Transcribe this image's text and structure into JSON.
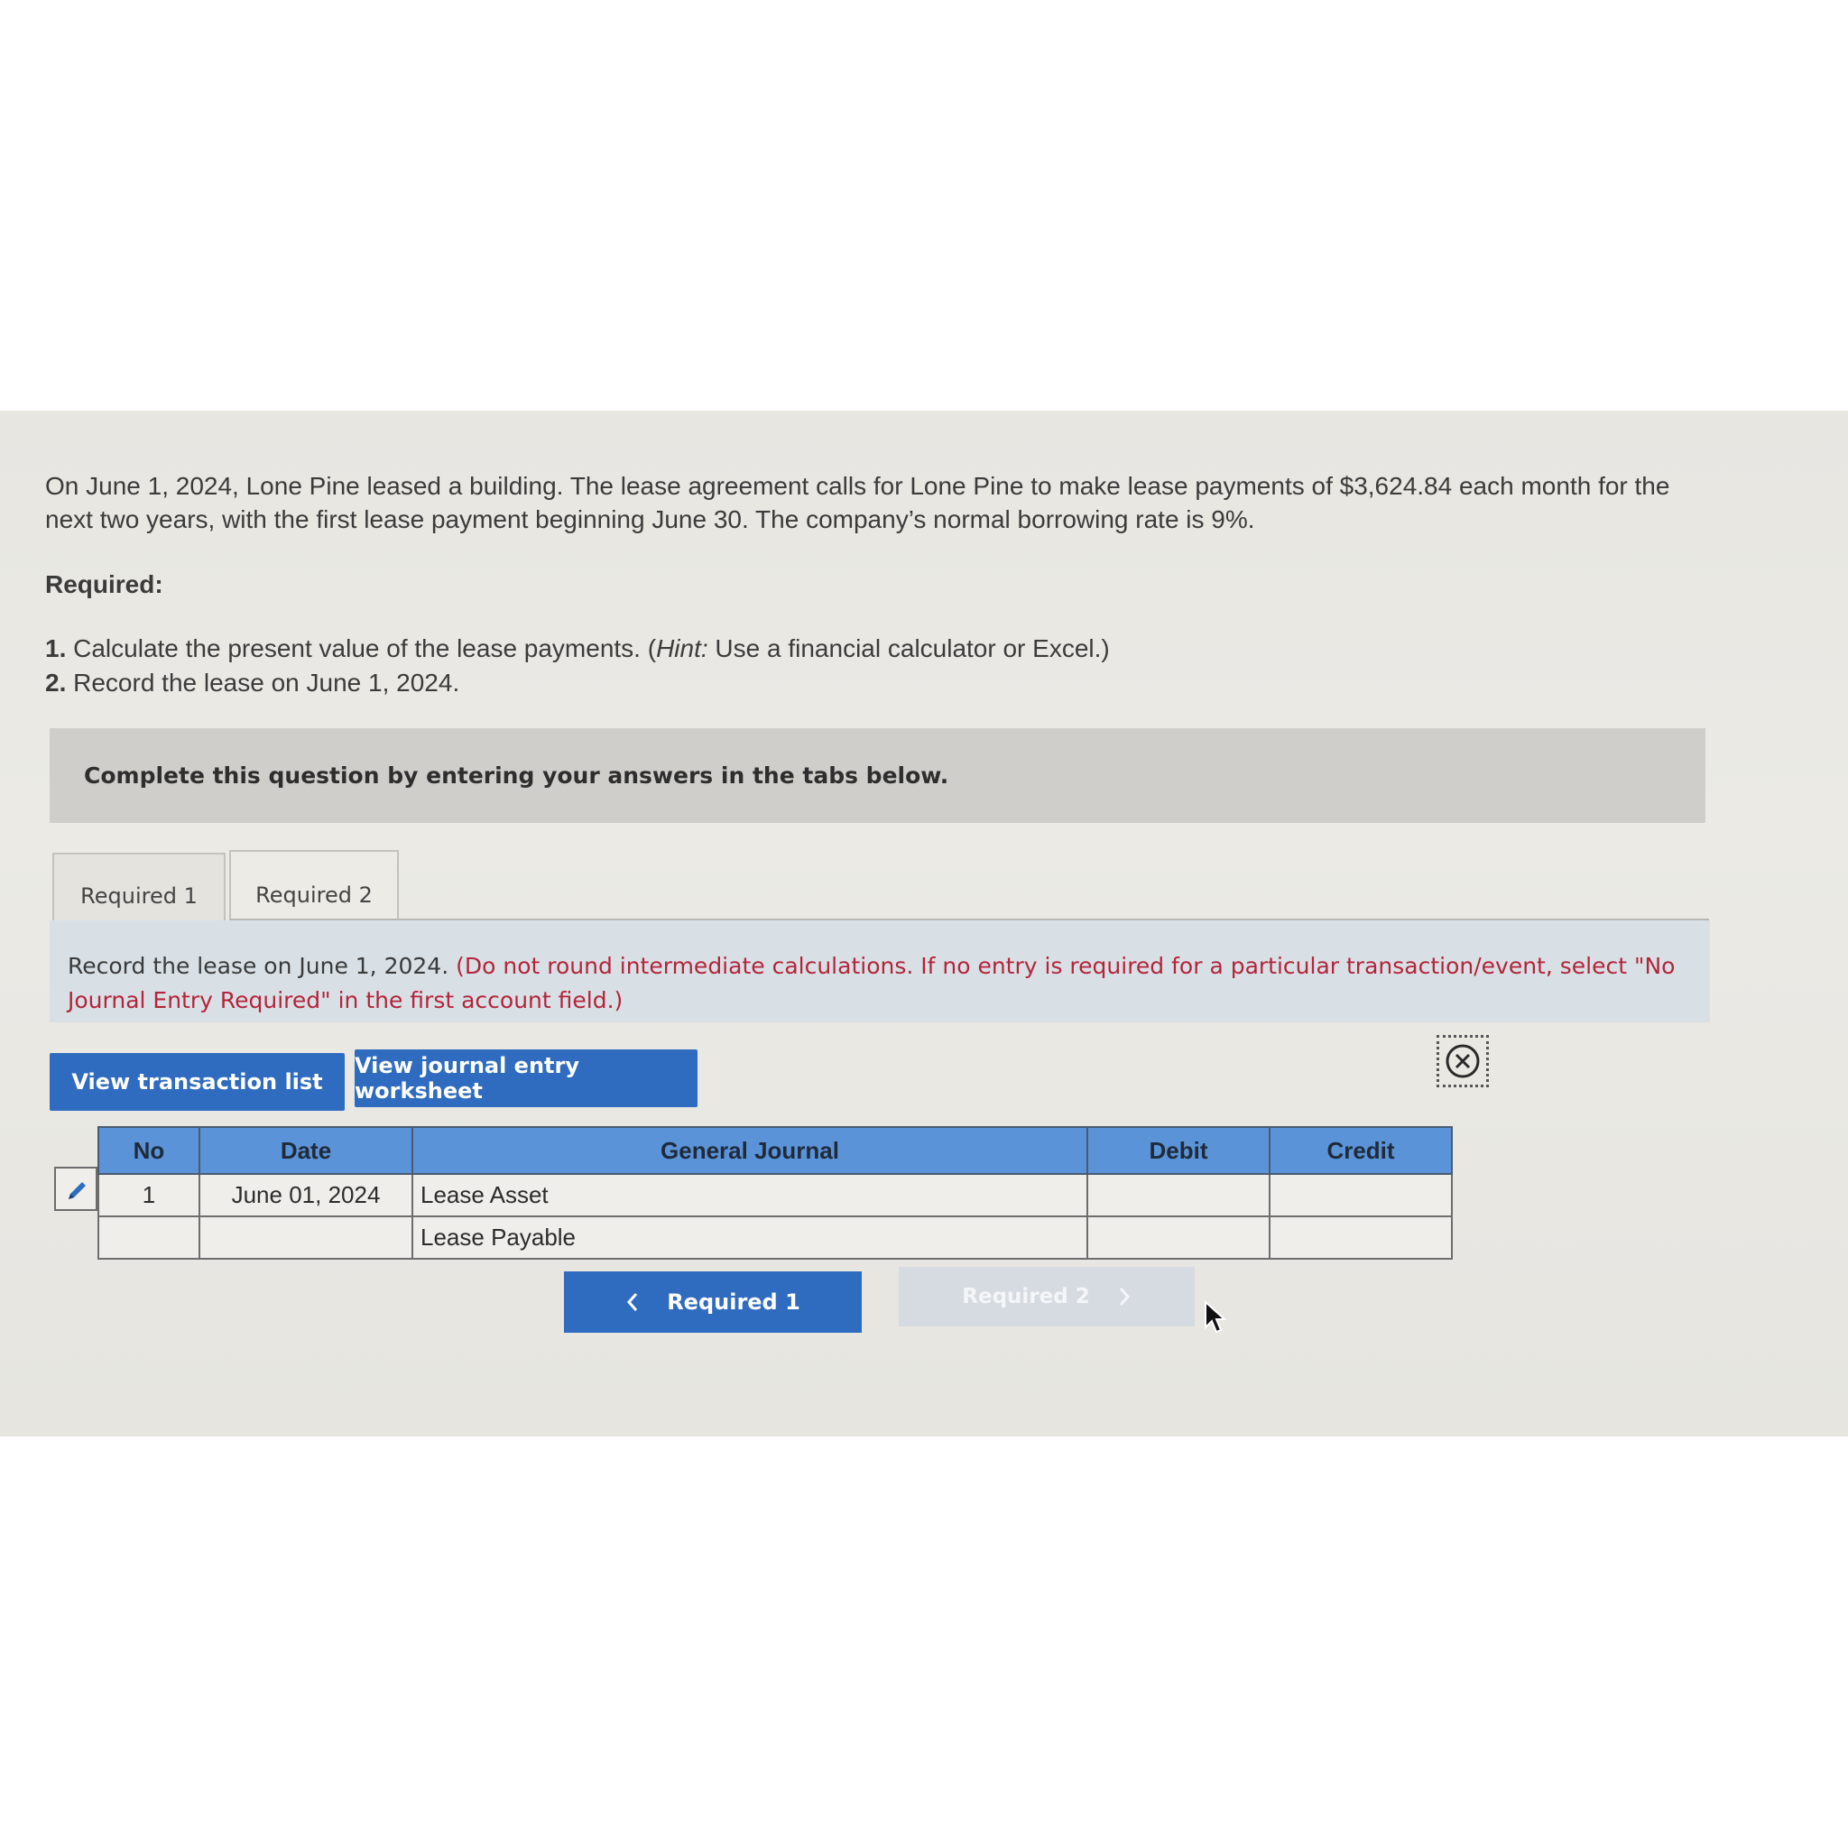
{
  "problem": {
    "text": "On June 1, 2024, Lone Pine leased a building. The lease agreement calls for Lone Pine to make lease payments of $3,624.84 each month for the next two years, with the first lease payment beginning June 30. The company’s normal borrowing rate is 9%."
  },
  "required": {
    "heading": "Required:",
    "items": [
      {
        "num": "1.",
        "text_before": " Calculate the present value of the lease payments. (",
        "hint": "Hint:",
        "text_after": " Use a financial calculator or Excel.)"
      },
      {
        "num": "2.",
        "text": " Record the lease on June 1, 2024."
      }
    ]
  },
  "banner": {
    "text": "Complete this question by entering your answers in the tabs below."
  },
  "tabs": [
    {
      "label": "Required 1",
      "active": false
    },
    {
      "label": "Required 2",
      "active": true
    }
  ],
  "instruction": {
    "lead": "Record the lease on June 1, 2024.",
    "note": " (Do not round intermediate calculations. If no entry is required for a particular transaction/event, select \"No Journal Entry Required\" in the first account field.)"
  },
  "buttons": {
    "view_transaction_list": "View transaction list",
    "view_journal_worksheet": "View journal entry worksheet"
  },
  "icons": {
    "close": "close-circle-icon",
    "edit": "pencil-icon",
    "cursor": "mouse-pointer-icon"
  },
  "journal": {
    "headers": {
      "no": "No",
      "date": "Date",
      "general_journal": "General Journal",
      "debit": "Debit",
      "credit": "Credit"
    },
    "rows": [
      {
        "no": "1",
        "date": "June 01, 2024",
        "account": "Lease Asset",
        "debit": "",
        "credit": ""
      },
      {
        "no": "",
        "date": "",
        "account": "Lease Payable",
        "debit": "",
        "credit": ""
      }
    ]
  },
  "navigation": {
    "prev_label": "Required 1",
    "next_label": "Required 2"
  },
  "colors": {
    "accent": "#2f6cc0",
    "header": "#5b93d8",
    "note_red": "#b3253a"
  }
}
